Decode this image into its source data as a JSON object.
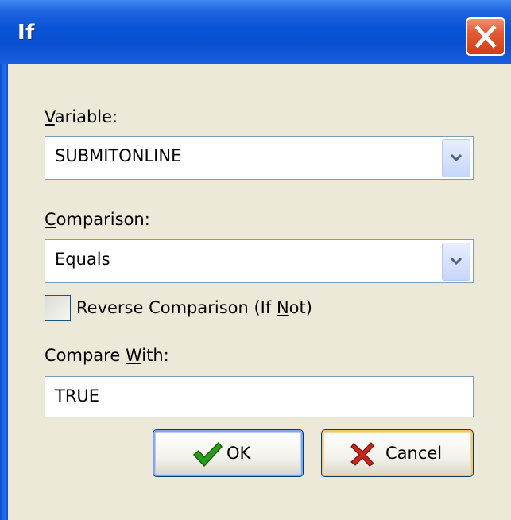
{
  "window": {
    "title": "If"
  },
  "variable": {
    "label_mnemonic": "V",
    "label_rest": "ariable:",
    "value": "SUBMITONLINE"
  },
  "comparison": {
    "label_mnemonic": "C",
    "label_rest": "omparison:",
    "value": "Equals"
  },
  "reverse": {
    "label_pre": "Reverse Comparison (If ",
    "label_mnemonic": "N",
    "label_post": "ot)",
    "checked": false
  },
  "compare_with": {
    "label_pre": "Compare ",
    "label_mnemonic": "W",
    "label_post": "ith:",
    "value": "TRUE"
  },
  "buttons": {
    "ok": "OK",
    "cancel": "Cancel"
  },
  "icons": {
    "close": "close-icon",
    "dropdown": "chevron-down-icon",
    "ok": "checkmark-icon",
    "cancel": "x-icon"
  },
  "colors": {
    "titlebar": "#0a4fd0",
    "client_bg": "#ece9d8",
    "close_btn": "#e25a33",
    "ok_check": "#2a9a1a",
    "cancel_x": "#c4281c"
  }
}
